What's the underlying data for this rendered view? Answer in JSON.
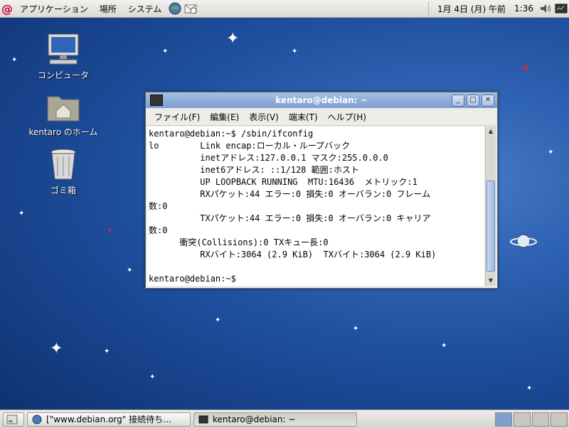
{
  "top_panel": {
    "menus": [
      "アプリケーション",
      "場所",
      "システム"
    ],
    "date": "1月 4日 (月) 午前",
    "time": "1:36"
  },
  "desktop": {
    "icons": [
      {
        "label": "コンピュータ",
        "icon": "computer-icon"
      },
      {
        "label": "kentaro のホーム",
        "icon": "home-folder-icon"
      },
      {
        "label": "ゴミ箱",
        "icon": "trash-icon"
      }
    ]
  },
  "terminal": {
    "title": "kentaro@debian: ~",
    "menus": [
      "ファイル(F)",
      "編集(E)",
      "表示(V)",
      "端末(T)",
      "ヘルプ(H)"
    ],
    "lines": [
      "kentaro@debian:~$ /sbin/ifconfig",
      "lo        Link encap:ローカル・ループバック",
      "          inetアドレス:127.0.0.1 マスク:255.0.0.0",
      "          inet6アドレス: ::1/128 範囲:ホスト",
      "          UP LOOPBACK RUNNING  MTU:16436  メトリック:1",
      "          RXパケット:44 エラー:0 損失:0 オーバラン:0 フレーム",
      "数:0",
      "          TXパケット:44 エラー:0 損失:0 オーバラン:0 キャリア",
      "数:0",
      "      衝突(Collisions):0 TXキュー長:0",
      "          RXバイト:3064 (2.9 KiB)  TXバイト:3064 (2.9 KiB)",
      "",
      "kentaro@debian:~$ "
    ]
  },
  "taskbar": {
    "tasks": [
      {
        "label": "[\"www.debian.org\" 接続待ち…",
        "icon": "browser-icon",
        "active": false
      },
      {
        "label": "kentaro@debian: ~",
        "icon": "terminal-icon",
        "active": true
      }
    ]
  }
}
